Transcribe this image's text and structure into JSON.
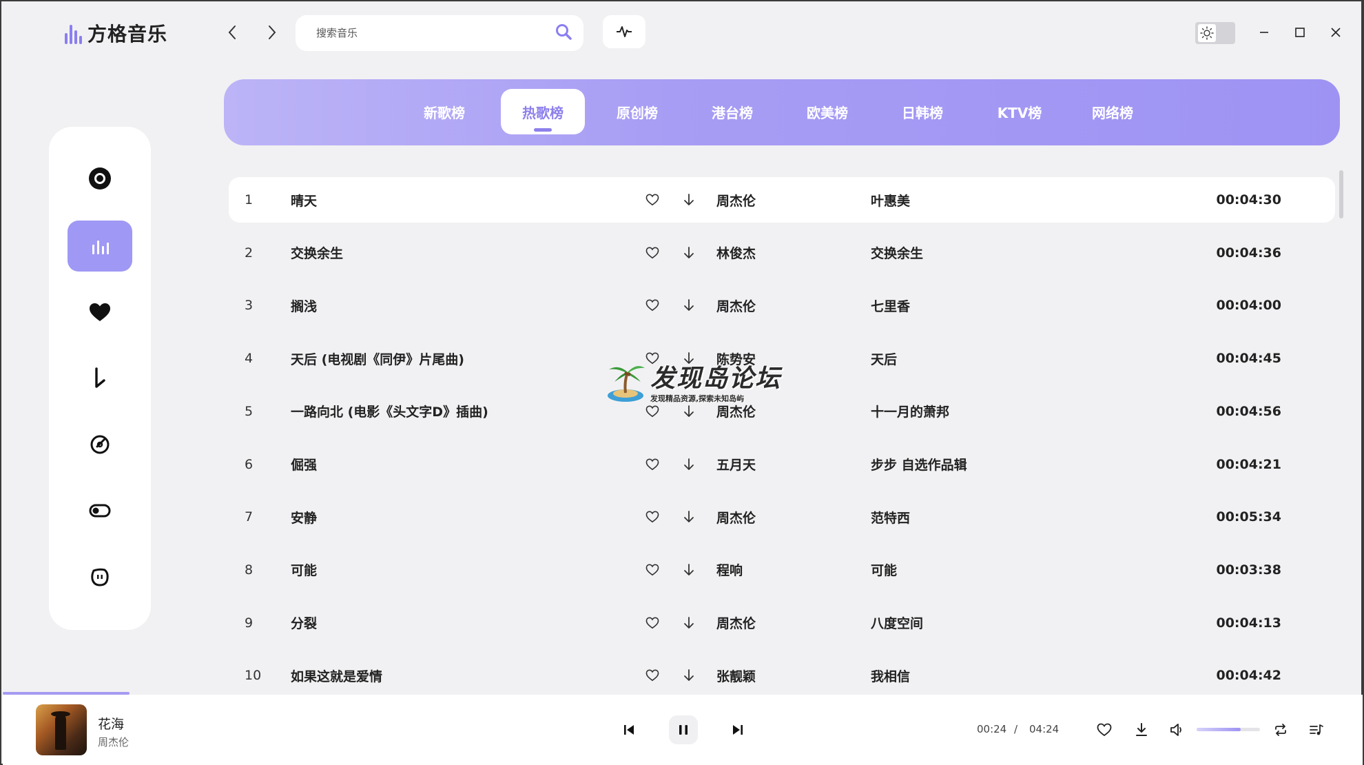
{
  "app": {
    "title": "方格音乐",
    "brand_color": "#9e93f3"
  },
  "header": {
    "search_placeholder": "搜索音乐",
    "icons": [
      "back-icon",
      "forward-icon",
      "search-icon",
      "waveform-icon",
      "sun-icon",
      "minimize-icon",
      "maximize-icon",
      "close-icon"
    ]
  },
  "sidebar": {
    "items": [
      {
        "icon": "disc-icon",
        "active": false
      },
      {
        "icon": "chart-icon",
        "active": true
      },
      {
        "icon": "heart-icon",
        "active": false
      },
      {
        "icon": "download-icon",
        "active": false
      },
      {
        "icon": "history-icon",
        "active": false
      },
      {
        "icon": "toggle-icon",
        "active": false
      },
      {
        "icon": "face-icon",
        "active": false
      }
    ]
  },
  "tabs": [
    {
      "label": "新歌榜"
    },
    {
      "label": "热歌榜",
      "active": true
    },
    {
      "label": "原创榜"
    },
    {
      "label": "港台榜"
    },
    {
      "label": "欧美榜"
    },
    {
      "label": "日韩榜"
    },
    {
      "label": "KTV榜"
    },
    {
      "label": "网络榜"
    }
  ],
  "songs": [
    {
      "num": "1",
      "name": "晴天",
      "artist": "周杰伦",
      "album": "叶惠美",
      "duration": "00:04:30"
    },
    {
      "num": "2",
      "name": "交换余生",
      "artist": "林俊杰",
      "album": "交换余生",
      "duration": "00:04:36"
    },
    {
      "num": "3",
      "name": "搁浅",
      "artist": "周杰伦",
      "album": "七里香",
      "duration": "00:04:00"
    },
    {
      "num": "4",
      "name": "天后 (电视剧《同伊》片尾曲)",
      "artist": "陈势安",
      "album": "天后",
      "duration": "00:04:45"
    },
    {
      "num": "5",
      "name": "一路向北 (电影《头文字D》插曲)",
      "artist": "周杰伦",
      "album": "十一月的萧邦",
      "duration": "00:04:56"
    },
    {
      "num": "6",
      "name": "倔强",
      "artist": "五月天",
      "album": "步步 自选作品辑",
      "duration": "00:04:21"
    },
    {
      "num": "7",
      "name": "安静",
      "artist": "周杰伦",
      "album": "范特西",
      "duration": "00:05:34"
    },
    {
      "num": "8",
      "name": "可能",
      "artist": "程响",
      "album": "可能",
      "duration": "00:03:38"
    },
    {
      "num": "9",
      "name": "分裂",
      "artist": "周杰伦",
      "album": "八度空间",
      "duration": "00:04:13"
    },
    {
      "num": "10",
      "name": "如果这就是爱情",
      "artist": "张靓颖",
      "album": "我相信",
      "duration": "00:04:42"
    }
  ],
  "watermark": {
    "title": "发现岛论坛",
    "subtitle": "发现精品资源,探索未知岛屿"
  },
  "player": {
    "title": "花海",
    "artist": "周杰伦",
    "current_time": "00:24",
    "separator": "/",
    "total_time": "04:24",
    "volume": 0.7,
    "progress": 0.09
  }
}
